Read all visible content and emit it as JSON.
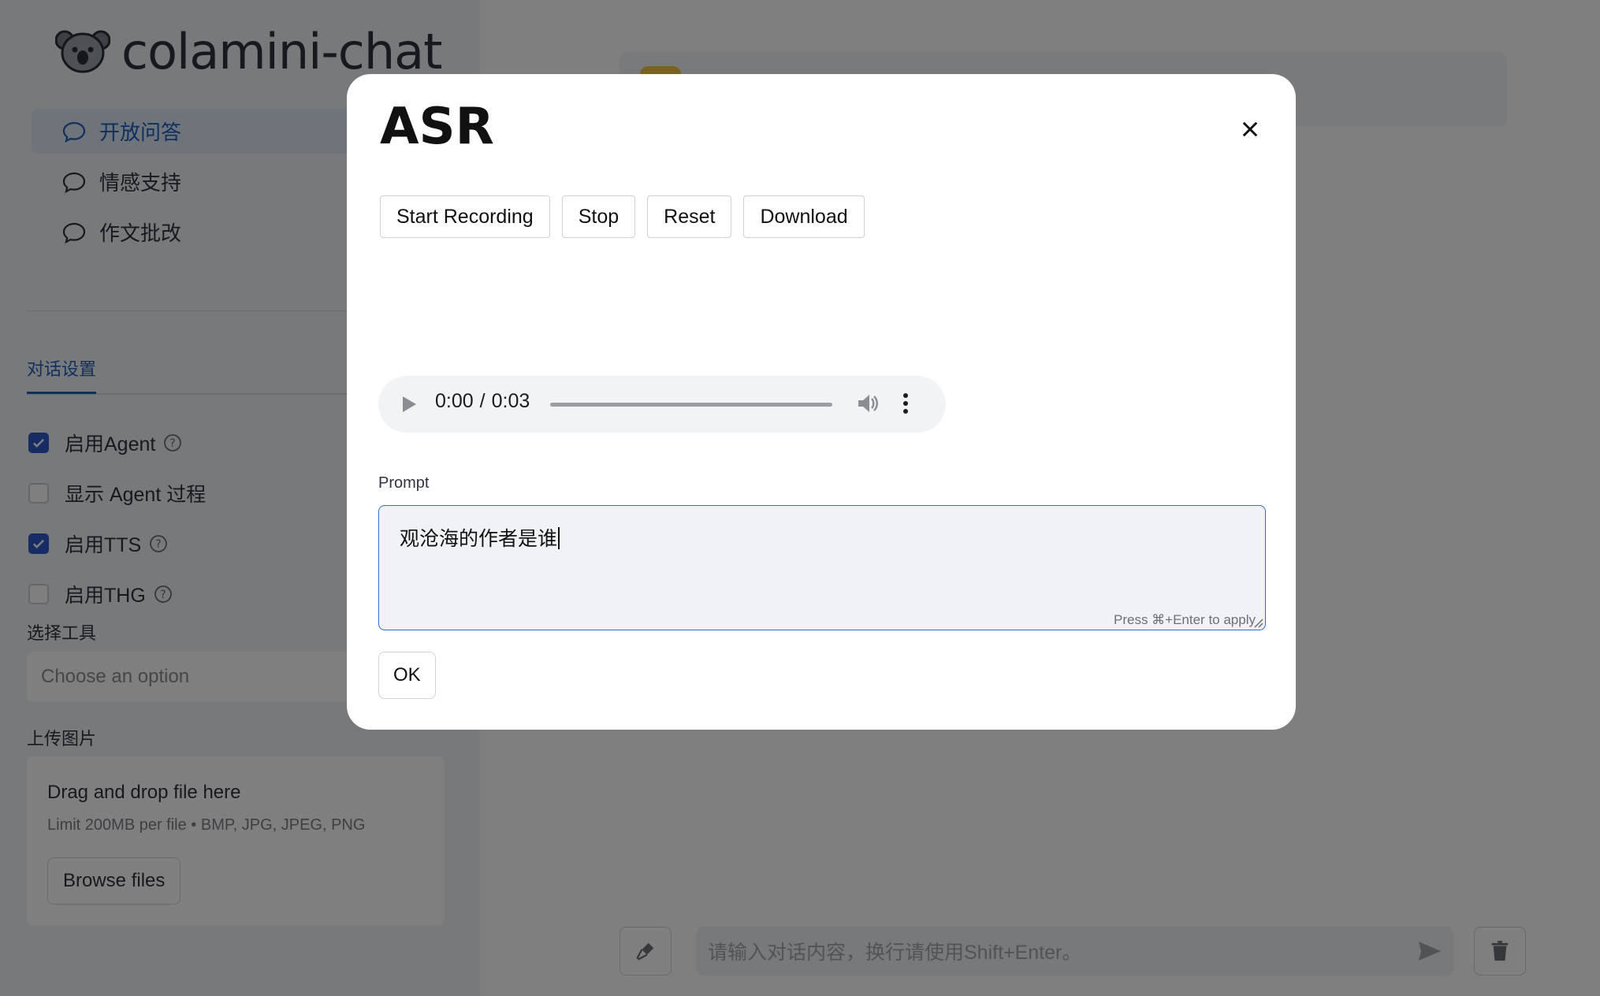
{
  "app": {
    "title": "colamini-chat"
  },
  "sidebar": {
    "nav": [
      {
        "label": "开放问答",
        "active": true
      },
      {
        "label": "情感支持",
        "active": false
      },
      {
        "label": "作文批改",
        "active": false
      }
    ],
    "tab": "对话设置",
    "checkboxes": [
      {
        "label": "启用Agent",
        "checked": true,
        "help": true
      },
      {
        "label": "显示 Agent 过程",
        "checked": false,
        "help": false
      },
      {
        "label": "启用TTS",
        "checked": true,
        "help": true
      },
      {
        "label": "启用THG",
        "checked": false,
        "help": true
      }
    ],
    "tool_label": "选择工具",
    "tool_placeholder": "Choose an option",
    "upload_label": "上传图片",
    "dropzone": {
      "title": "Drag and drop file here",
      "subtitle": "Limit 200MB per file • BMP, JPG, JPEG, PNG",
      "browse": "Browse files"
    }
  },
  "chat": {
    "placeholder": "请输入对话内容，换行请使用Shift+Enter。"
  },
  "modal": {
    "title": "ASR",
    "buttons": {
      "start": "Start Recording",
      "stop": "Stop",
      "reset": "Reset",
      "download": "Download"
    },
    "audio": {
      "current": "0:00",
      "sep": "/",
      "duration": "0:03"
    },
    "prompt_label": "Prompt",
    "prompt_value": "观沧海的作者是谁",
    "prompt_hint": "Press ⌘+Enter to apply",
    "ok": "OK"
  },
  "colors": {
    "accent": "#2f58c9",
    "link": "#1f5fbf",
    "overlay": "rgba(0,0,0,0.5)"
  }
}
